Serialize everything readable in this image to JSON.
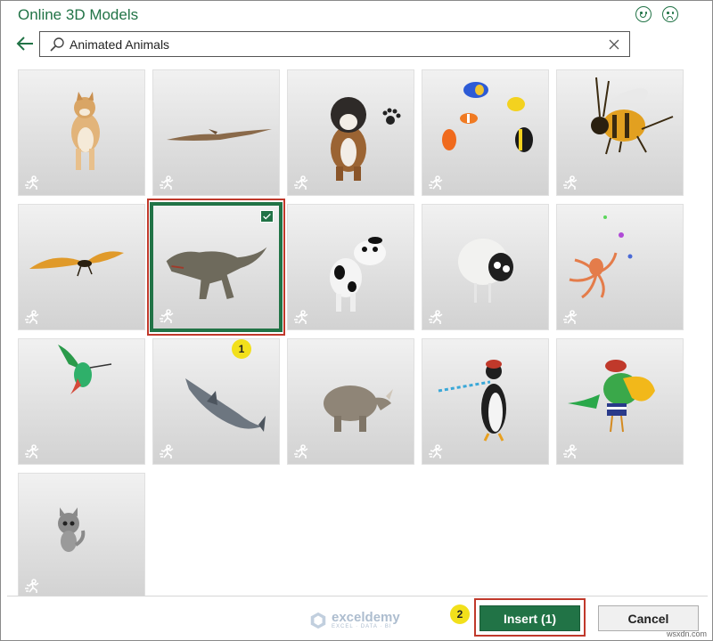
{
  "dialog": {
    "title": "Online 3D Models"
  },
  "search": {
    "value": "Animated Animals",
    "placeholder": ""
  },
  "models": [
    {
      "name": "shiba-inu-dog",
      "selected": false
    },
    {
      "name": "pterodactyl",
      "selected": false
    },
    {
      "name": "boxer-dog-with-paw",
      "selected": false
    },
    {
      "name": "tropical-fish",
      "selected": false
    },
    {
      "name": "bee",
      "selected": false
    },
    {
      "name": "butterfly",
      "selected": false
    },
    {
      "name": "t-rex",
      "selected": true
    },
    {
      "name": "cow",
      "selected": false
    },
    {
      "name": "sheep",
      "selected": false
    },
    {
      "name": "octopus",
      "selected": false
    },
    {
      "name": "hummingbird",
      "selected": false
    },
    {
      "name": "shark",
      "selected": false
    },
    {
      "name": "rhinoceros",
      "selected": false
    },
    {
      "name": "penguin",
      "selected": false
    },
    {
      "name": "parrot",
      "selected": false
    },
    {
      "name": "cat",
      "selected": false
    }
  ],
  "annotations": {
    "step1": "1",
    "step2": "2"
  },
  "footer": {
    "insert_label": "Insert (1)",
    "cancel_label": "Cancel",
    "watermark_name": "exceldemy",
    "watermark_tagline": "EXCEL · DATA · BI",
    "site": "wsxdn.com"
  },
  "colors": {
    "accent": "#217346",
    "annotation_box": "#c0392b",
    "badge": "#f2e01b"
  }
}
